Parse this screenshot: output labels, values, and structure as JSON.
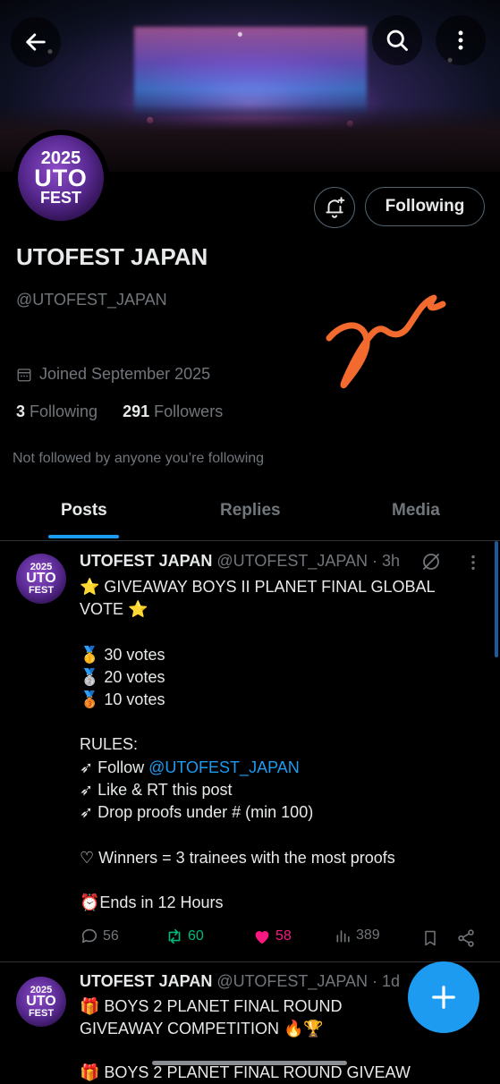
{
  "header": {
    "back_icon": "arrow-left-icon",
    "search_icon": "search-icon",
    "more_icon": "more-vertical-icon"
  },
  "profile": {
    "avatar_text": {
      "year": "2025",
      "line1": "UTO",
      "line2": "FEST"
    },
    "display_name": "UTOFEST JAPAN",
    "handle": "@UTOFEST_JAPAN",
    "joined": "Joined September 2025",
    "following_count": "3",
    "following_label": "Following",
    "followers_count": "291",
    "followers_label": "Followers",
    "not_followed": "Not followed by anyone you’re following",
    "follow_button": "Following"
  },
  "tabs": [
    {
      "label": "Posts",
      "active": true
    },
    {
      "label": "Replies",
      "active": false
    },
    {
      "label": "Media",
      "active": false
    }
  ],
  "posts": [
    {
      "name": "UTOFEST JAPAN",
      "handle_time": "@UTOFEST_JAPAN · 3h",
      "lines": {
        "l1": "⭐ GIVEAWAY BOYS II PLANET FINAL GLOBAL VOTE ⭐",
        "l2": "🥇 30 votes",
        "l3": "🥈 20 votes",
        "l4": "🥉 10 votes",
        "l5": "RULES:",
        "l6a": "➶ Follow ",
        "l6b": "@UTOFEST_JAPAN",
        "l7": "➶ Like & RT this post",
        "l8": "➶ Drop proofs under # (min 100)",
        "l9": "♡ Winners = 3 trainees with the most proofs",
        "l10": "⏰Ends in 12 Hours"
      },
      "replies": "56",
      "reposts": "60",
      "likes": "58",
      "views": "389"
    },
    {
      "name": "UTOFEST JAPAN",
      "handle_time": "@UTOFEST_JAPAN · 1d",
      "lines": {
        "l1": "🎁 BOYS 2 PLANET FINAL ROUND GIVEAWAY COMPETITION 🔥🏆",
        "l2": "🎁 BOYS 2 PLANET FINAL ROUND GIVEAW"
      }
    }
  ],
  "colors": {
    "accent": "#1d9bf0",
    "like": "#f91880",
    "repost": "#00ba7c",
    "muted": "#71767b"
  }
}
